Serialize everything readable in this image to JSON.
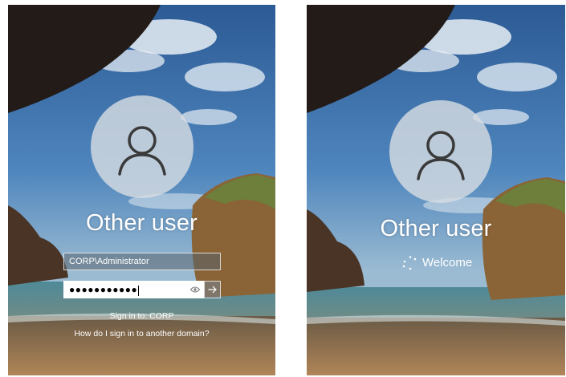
{
  "login_screen": {
    "user_display_name": "Other user",
    "username_value": "CORP\\Administrator",
    "password_masked": "●●●●●●●●●●●",
    "sign_in_to_text": "Sign in to: CORP",
    "other_domain_link": "How do I sign in to another domain?"
  },
  "welcome_screen": {
    "user_display_name": "Other user",
    "status_text": "Welcome"
  },
  "icons": {
    "avatar": "person-icon",
    "reveal_password": "eye-icon",
    "submit": "arrow-right-icon",
    "progress": "spinner-icon"
  },
  "colors": {
    "sky_top": "#2d5f9a",
    "sea": "#3f7e8f",
    "sand": "#8a6b47",
    "rock": "#2a2320"
  }
}
